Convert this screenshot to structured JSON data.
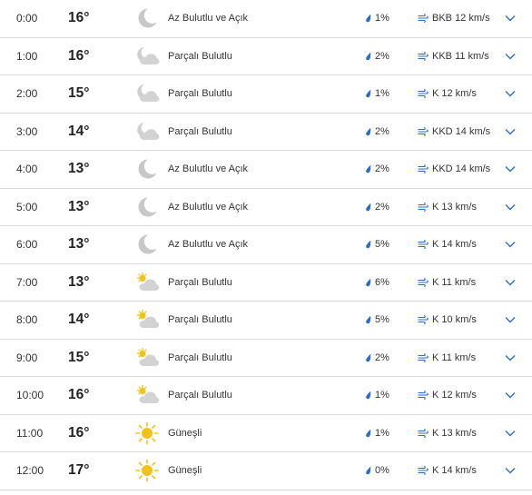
{
  "colors": {
    "accent": "#2b6cc4",
    "divider": "#dadada",
    "moon": "#c8c8c8",
    "cloud": "#c8c8c8",
    "sun": "#f2c21b"
  },
  "hourly": [
    {
      "time": "0:00",
      "temp": "16°",
      "icon": "moon-icon",
      "condition": "Az Bulutlu ve Açık",
      "precip": "1%",
      "wind": "BKB 12 km/s"
    },
    {
      "time": "1:00",
      "temp": "16°",
      "icon": "moon-cloud-icon",
      "condition": "Parçalı Bulutlu",
      "precip": "2%",
      "wind": "KKB 11 km/s"
    },
    {
      "time": "2:00",
      "temp": "15°",
      "icon": "moon-cloud-icon",
      "condition": "Parçalı Bulutlu",
      "precip": "1%",
      "wind": "K 12 km/s"
    },
    {
      "time": "3:00",
      "temp": "14°",
      "icon": "moon-cloud-icon",
      "condition": "Parçalı Bulutlu",
      "precip": "2%",
      "wind": "KKD 14 km/s"
    },
    {
      "time": "4:00",
      "temp": "13°",
      "icon": "moon-icon",
      "condition": "Az Bulutlu ve Açık",
      "precip": "2%",
      "wind": "KKD 14 km/s"
    },
    {
      "time": "5:00",
      "temp": "13°",
      "icon": "moon-icon",
      "condition": "Az Bulutlu ve Açık",
      "precip": "2%",
      "wind": "K 13 km/s"
    },
    {
      "time": "6:00",
      "temp": "13°",
      "icon": "moon-icon",
      "condition": "Az Bulutlu ve Açık",
      "precip": "5%",
      "wind": "K 14 km/s"
    },
    {
      "time": "7:00",
      "temp": "13°",
      "icon": "sun-cloud-icon",
      "condition": "Parçalı Bulutlu",
      "precip": "6%",
      "wind": "K 11 km/s"
    },
    {
      "time": "8:00",
      "temp": "14°",
      "icon": "sun-cloud-icon",
      "condition": "Parçalı Bulutlu",
      "precip": "5%",
      "wind": "K 10 km/s"
    },
    {
      "time": "9:00",
      "temp": "15°",
      "icon": "sun-cloud-icon",
      "condition": "Parçalı Bulutlu",
      "precip": "2%",
      "wind": "K 11 km/s"
    },
    {
      "time": "10:00",
      "temp": "16°",
      "icon": "sun-cloud-icon",
      "condition": "Parçalı Bulutlu",
      "precip": "1%",
      "wind": "K 12 km/s"
    },
    {
      "time": "11:00",
      "temp": "16°",
      "icon": "sun-icon",
      "condition": "Güneşli",
      "precip": "1%",
      "wind": "K 13 km/s"
    },
    {
      "time": "12:00",
      "temp": "17°",
      "icon": "sun-icon",
      "condition": "Güneşli",
      "precip": "0%",
      "wind": "K 14 km/s"
    }
  ]
}
